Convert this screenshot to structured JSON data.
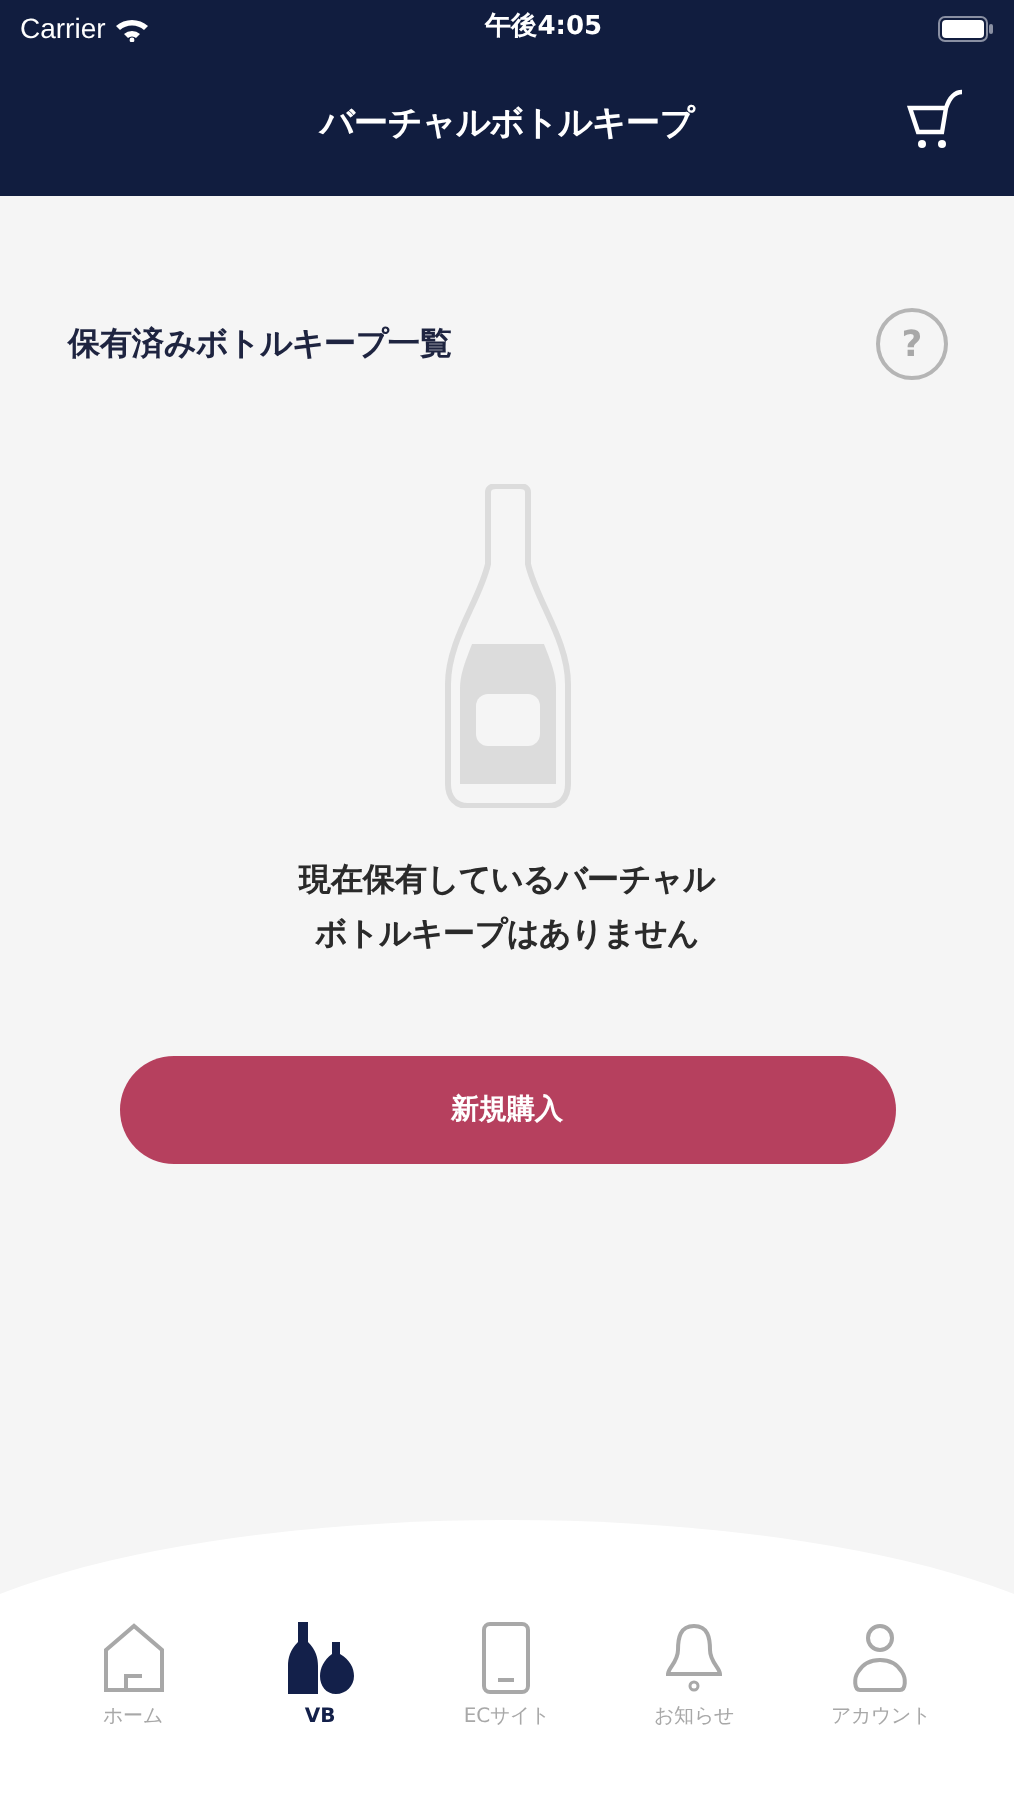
{
  "status_bar": {
    "carrier": "Carrier",
    "time": "午後4:05"
  },
  "nav": {
    "title": "バーチャルボトルキープ"
  },
  "section": {
    "title": "保有済みボトルキープ一覧",
    "help": "?"
  },
  "empty_message": [
    "現在保有しているバーチャル",
    "ボトルキープはありません"
  ],
  "primary_button": "新規購入",
  "tabs": [
    {
      "kind": "home",
      "label": "ホーム",
      "selected": false
    },
    {
      "kind": "bottles",
      "label": "VB",
      "selected": true
    },
    {
      "kind": "phone",
      "label": "ECサイト",
      "selected": false
    },
    {
      "kind": "bell",
      "label": "お知らせ",
      "selected": false
    },
    {
      "kind": "person",
      "label": "アカウント",
      "selected": false
    }
  ]
}
